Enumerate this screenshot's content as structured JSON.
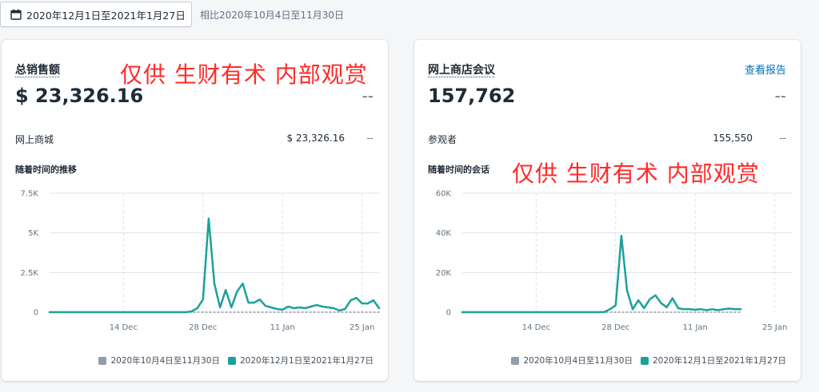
{
  "toolbar": {
    "date_range_label": "2020年12月1日至2021年1月27日",
    "compare_label": "相比2020年10月4日至11月30日"
  },
  "colors": {
    "current": "#1ca19a",
    "previous": "#919eab"
  },
  "watermark": "仅供 生财有术 内部观赏",
  "sales_card": {
    "title": "总销售额",
    "value": "$ 23,326.16",
    "compare": "--",
    "row_label": "网上商城",
    "row_value": "$ 23,326.16",
    "row_compare": "--",
    "chart_title": "随着时间的推移",
    "legend_previous": "2020年10月4日至11月30日",
    "legend_current": "2020年12月1日至2021年1月27日"
  },
  "sessions_card": {
    "title": "网上商店会议",
    "link": "查看报告",
    "value": "157,762",
    "compare": "--",
    "row_label": "参观者",
    "row_value": "155,550",
    "row_compare": "--",
    "chart_title": "随着时间的会话",
    "legend_previous": "2020年10月4日至11月30日",
    "legend_current": "2020年12月1日至2021年1月27日"
  },
  "chart_data": [
    {
      "type": "line",
      "ylim": [
        0,
        7500
      ],
      "yticks": [
        "0",
        "2.5K",
        "5K",
        "7.5K"
      ],
      "ytick_values": [
        0,
        2500,
        5000,
        7500
      ],
      "xticks": [
        "14 Dec",
        "28 Dec",
        "11 Jan",
        "25 Jan"
      ],
      "xtick_days": [
        13,
        27,
        41,
        55
      ],
      "x_days": 58,
      "series": [
        {
          "name": "2020年12月1日至2021年1月27日",
          "values": [
            0,
            0,
            0,
            0,
            0,
            0,
            0,
            0,
            0,
            0,
            0,
            0,
            0,
            0,
            0,
            0,
            0,
            0,
            0,
            0,
            0,
            0,
            0,
            0,
            0,
            50,
            250,
            800,
            5900,
            1800,
            300,
            1400,
            300,
            1300,
            1800,
            600,
            600,
            800,
            400,
            300,
            200,
            150,
            350,
            250,
            300,
            250,
            350,
            450,
            350,
            300,
            250,
            100,
            200,
            750,
            900,
            550,
            550,
            750,
            250
          ],
          "color": "#1ca19a"
        },
        {
          "name": "2020年10月4日至11月30日",
          "values": [
            0,
            0,
            0,
            0,
            0,
            0,
            0,
            0,
            0,
            0,
            0,
            0,
            0,
            0,
            0,
            0,
            0,
            0,
            0,
            0,
            0,
            0,
            0,
            0,
            0,
            0,
            0,
            0,
            0,
            0,
            0,
            0,
            0,
            0,
            0,
            0,
            0,
            0,
            0,
            0,
            0,
            0,
            0,
            0,
            0,
            0,
            0,
            0,
            0,
            0,
            0,
            0,
            0,
            0,
            0,
            0,
            0,
            0,
            0
          ],
          "color": "#919eab"
        }
      ]
    },
    {
      "type": "line",
      "ylim": [
        0,
        60000
      ],
      "yticks": [
        "0",
        "20K",
        "40K",
        "60K"
      ],
      "ytick_values": [
        0,
        20000,
        40000,
        60000
      ],
      "xticks": [
        "14 Dec",
        "28 Dec",
        "11 Jan",
        "25 Jan"
      ],
      "xtick_days": [
        13,
        27,
        41,
        55
      ],
      "x_days": 58,
      "series": [
        {
          "name": "2020年12月1日至2021年1月27日",
          "values": [
            0,
            0,
            0,
            0,
            0,
            0,
            0,
            0,
            0,
            0,
            0,
            0,
            0,
            0,
            0,
            0,
            0,
            0,
            0,
            0,
            0,
            0,
            0,
            0,
            0,
            100,
            1500,
            3500,
            38500,
            11000,
            1500,
            6000,
            2000,
            6500,
            8500,
            4500,
            2500,
            7000,
            2000,
            1500,
            1500,
            1200,
            1500,
            1000,
            1500,
            1000,
            1500,
            1800,
            1500,
            1500
          ],
          "color": "#1ca19a"
        },
        {
          "name": "2020年10月4日至11月30日",
          "values": [
            0,
            0,
            0,
            0,
            0,
            0,
            0,
            0,
            0,
            0,
            0,
            0,
            0,
            0,
            0,
            0,
            0,
            0,
            0,
            0,
            0,
            0,
            0,
            0,
            0,
            0,
            0,
            0,
            0,
            0,
            0,
            0,
            0,
            0,
            0,
            0,
            0,
            0,
            0,
            0,
            0,
            0,
            0,
            0,
            0,
            0,
            0,
            0,
            0,
            0
          ],
          "color": "#919eab"
        }
      ]
    }
  ]
}
